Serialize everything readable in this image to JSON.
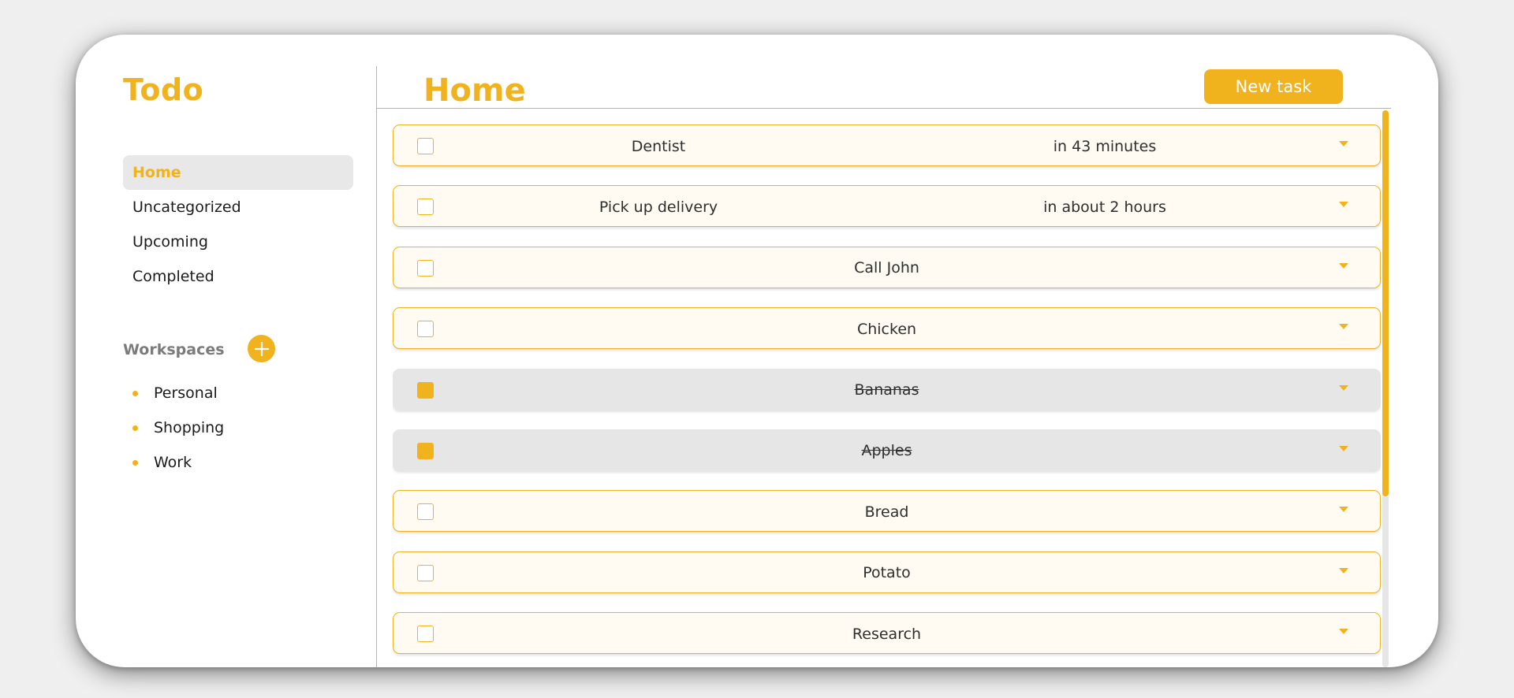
{
  "app": {
    "brand": "Todo",
    "accent_color": "#f0b31e"
  },
  "sidebar": {
    "nav": [
      {
        "label": "Home",
        "active": true
      },
      {
        "label": "Uncategorized",
        "active": false
      },
      {
        "label": "Upcoming",
        "active": false
      },
      {
        "label": "Completed",
        "active": false
      }
    ],
    "workspaces": {
      "title": "Workspaces",
      "add_icon": "plus-icon",
      "items": [
        "Personal",
        "Shopping",
        "Work"
      ]
    }
  },
  "main": {
    "title": "Home",
    "new_task_label": "New task",
    "tasks": [
      {
        "name": "Dentist",
        "time": "in 43 minutes",
        "done": false
      },
      {
        "name": "Pick up delivery",
        "time": "in about 2 hours",
        "done": false
      },
      {
        "name": "Call John",
        "time": "",
        "done": false
      },
      {
        "name": "Chicken",
        "time": "",
        "done": false
      },
      {
        "name": "Bananas",
        "time": "",
        "done": true
      },
      {
        "name": "Apples",
        "time": "",
        "done": true
      },
      {
        "name": "Bread",
        "time": "",
        "done": false
      },
      {
        "name": "Potato",
        "time": "",
        "done": false
      },
      {
        "name": "Research",
        "time": "",
        "done": false
      }
    ]
  }
}
